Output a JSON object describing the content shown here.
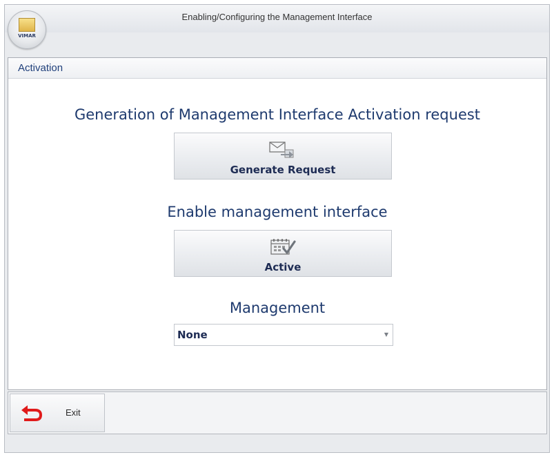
{
  "window": {
    "title": "Enabling/Configuring the Management Interface",
    "logo_text": "VIMAR"
  },
  "panel": {
    "header_label": "Activation",
    "generate_section": {
      "heading": "Generation of Management Interface Activation request",
      "button_label": "Generate Request",
      "icon": "envelope-arrow-icon"
    },
    "enable_section": {
      "heading": "Enable management interface",
      "button_label": "Active",
      "icon": "calendar-check-icon"
    },
    "management_section": {
      "heading": "Management",
      "selected_value": "None"
    }
  },
  "footer": {
    "exit_label": "Exit",
    "exit_icon": "undo-arrow-icon"
  },
  "colors": {
    "heading": "#1e3a6e",
    "button_text": "#1e2c54",
    "exit_icon": "#e01a1a"
  }
}
